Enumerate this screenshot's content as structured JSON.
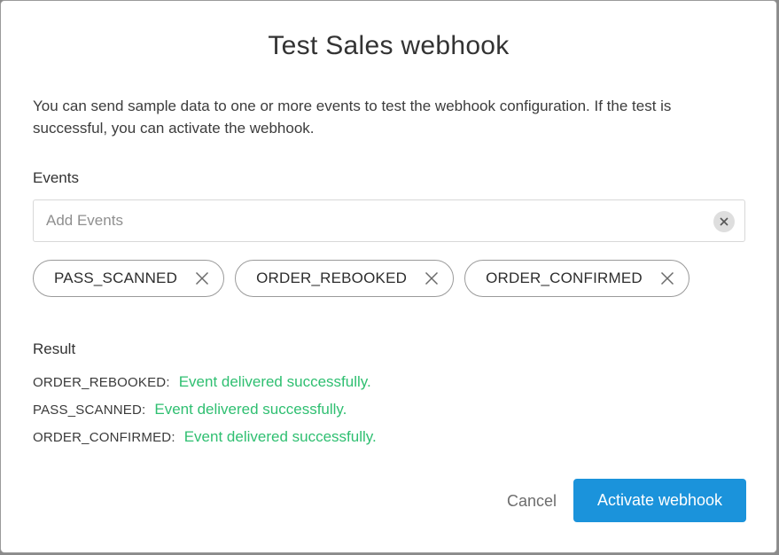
{
  "dialog": {
    "title": "Test Sales webhook",
    "description": "You can send sample data to one or more events to test the webhook configuration. If the test is successful, you can activate the webhook."
  },
  "events": {
    "label": "Events",
    "input_placeholder": "Add Events",
    "input_value": "",
    "clear_icon": "clear-circle-icon",
    "chips": [
      {
        "label": "PASS_SCANNED",
        "remove_icon": "close-icon"
      },
      {
        "label": "ORDER_REBOOKED",
        "remove_icon": "close-icon"
      },
      {
        "label": "ORDER_CONFIRMED",
        "remove_icon": "close-icon"
      }
    ]
  },
  "result": {
    "label": "Result",
    "rows": [
      {
        "event": "ORDER_REBOOKED:",
        "status": "Event delivered successfully."
      },
      {
        "event": "PASS_SCANNED:",
        "status": "Event delivered successfully."
      },
      {
        "event": "ORDER_CONFIRMED:",
        "status": "Event delivered successfully."
      }
    ],
    "success_color": "#2fbf71"
  },
  "actions": {
    "cancel_label": "Cancel",
    "activate_label": "Activate webhook",
    "primary_color": "#1b93db"
  }
}
